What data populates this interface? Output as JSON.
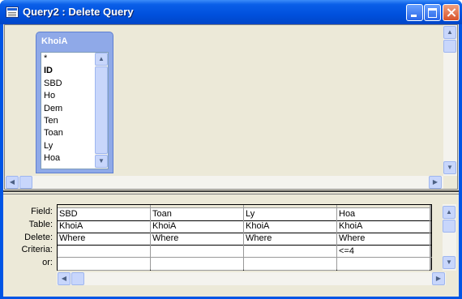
{
  "window": {
    "title": "Query2 : Delete Query"
  },
  "table_box": {
    "name": "KhoiA",
    "fields": [
      "*",
      "ID",
      "SBD",
      "Ho",
      "Dem",
      "Ten",
      "Toan",
      "Ly",
      "Hoa"
    ]
  },
  "grid": {
    "row_labels": [
      "Field:",
      "Table:",
      "Delete:",
      "Criteria:",
      "or:"
    ],
    "columns": [
      {
        "field": "SBD",
        "table": "KhoiA",
        "delete": "Where",
        "criteria": "",
        "or": ""
      },
      {
        "field": "Toan",
        "table": "KhoiA",
        "delete": "Where",
        "criteria": "",
        "or": ""
      },
      {
        "field": "Ly",
        "table": "KhoiA",
        "delete": "Where",
        "criteria": "",
        "or": ""
      },
      {
        "field": "Hoa",
        "table": "KhoiA",
        "delete": "Where",
        "criteria": "<=4",
        "or": ""
      },
      {
        "field": "",
        "table": "",
        "delete": "",
        "criteria": "",
        "or": ""
      }
    ]
  },
  "icons": {
    "title": "query-window-icon",
    "scroll_up": "scroll-up-arrow-icon",
    "scroll_down": "scroll-down-arrow-icon",
    "scroll_left": "scroll-left-arrow-icon",
    "scroll_right": "scroll-right-arrow-icon"
  },
  "colors": {
    "titlebar": "#0050dd",
    "table_header": "#8fa9e8",
    "window_bg": "#ece9d8"
  }
}
